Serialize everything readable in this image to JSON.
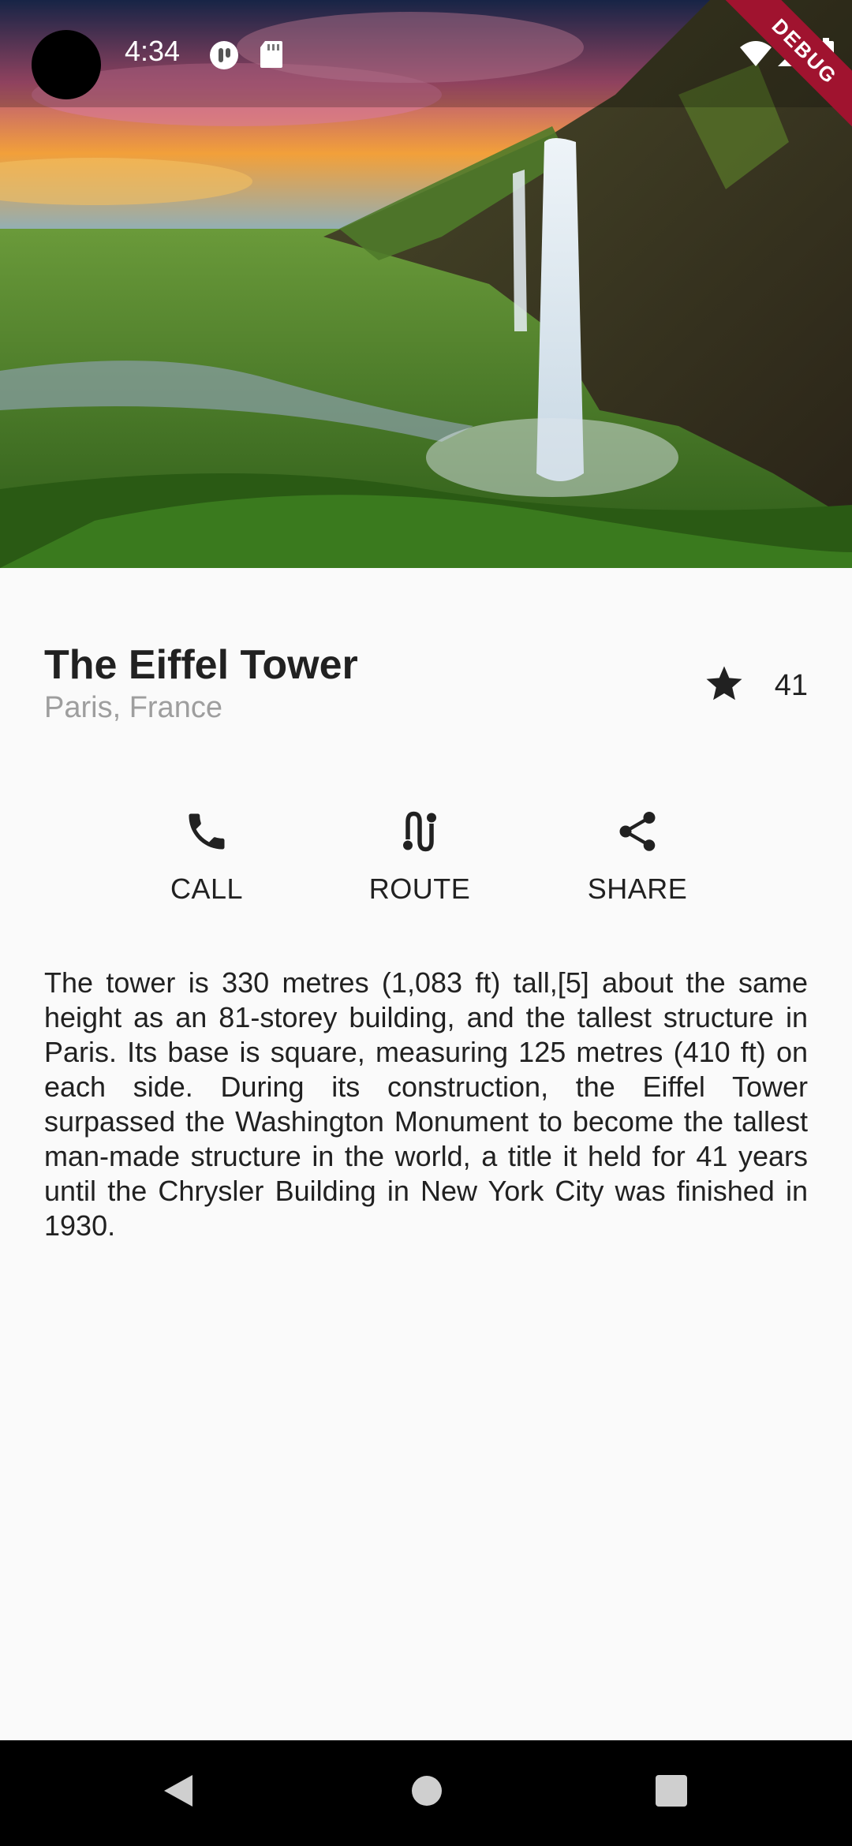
{
  "status_bar": {
    "time": "4:34",
    "icons": [
      "notification-icon",
      "sd-card-icon",
      "wifi-icon",
      "signal-icon",
      "battery-icon"
    ]
  },
  "debug_banner": "DEBUG",
  "place": {
    "title": "The Eiffel Tower",
    "location": "Paris, France",
    "rating_count": "41",
    "rating_icon": "star-icon"
  },
  "actions": [
    {
      "label": "CALL",
      "icon": "phone-icon"
    },
    {
      "label": "ROUTE",
      "icon": "route-icon"
    },
    {
      "label": "SHARE",
      "icon": "share-icon"
    }
  ],
  "description": "The tower is 330 metres (1,083 ft) tall,[5] about the same height as an 81-storey building, and the tallest structure in Paris. Its base is square, measuring 125 metres (410 ft) on each side. During its construction, the Eiffel Tower surpassed the Washington Monument to become the tallest man-made structure in the world, a title it held for 41 years until the Chrysler Building in New York City was finished in 1930.",
  "colors": {
    "background": "#fafafa",
    "text_primary": "#212121",
    "text_secondary": "#9e9e9e",
    "debug_banner": "#a0132f",
    "nav_bar": "#000000"
  }
}
